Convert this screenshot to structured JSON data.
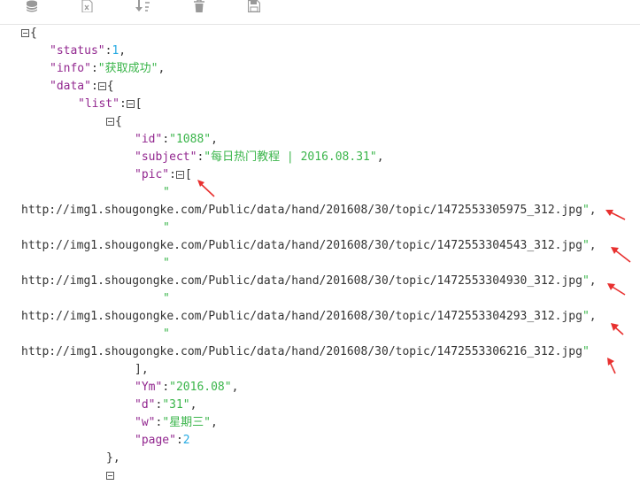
{
  "toolbar": {
    "items": [
      {
        "name": "database-icon"
      },
      {
        "name": "excel-export-icon"
      },
      {
        "name": "sort-icon"
      },
      {
        "name": "trash-icon"
      },
      {
        "name": "save-icon"
      }
    ]
  },
  "json": {
    "open_brace": "{",
    "close_brace": "}",
    "status_key": "\"status\"",
    "status_value": "1",
    "info_key": "\"info\"",
    "info_value": "\"获取成功\"",
    "data_key": "\"data\"",
    "list_key": "\"list\"",
    "open_bracket": "[",
    "close_bracket": "]",
    "colon": ":",
    "comma": ",",
    "quote": "\"",
    "id_key": "\"id\"",
    "id_value": "\"1088\"",
    "subject_key": "\"subject\"",
    "subject_value": "\"每日热门教程 | 2016.08.31\"",
    "pic_key": "\"pic\"",
    "pic_urls": [
      "http://img1.shougongke.com/Public/data/hand/201608/30/topic/1472553305975_312.jpg",
      "http://img1.shougongke.com/Public/data/hand/201608/30/topic/1472553304543_312.jpg",
      "http://img1.shougongke.com/Public/data/hand/201608/30/topic/1472553304930_312.jpg",
      "http://img1.shougongke.com/Public/data/hand/201608/30/topic/1472553304293_312.jpg",
      "http://img1.shougongke.com/Public/data/hand/201608/30/topic/1472553306216_312.jpg"
    ],
    "ym_key": "\"Ym\"",
    "ym_value": "\"2016.08\"",
    "d_key": "\"d\"",
    "d_value": "\"31\"",
    "w_key": "\"w\"",
    "w_value": "\"星期三\"",
    "page_key": "\"page\"",
    "page_value": "2",
    "item_close": "},"
  },
  "annotation": {
    "arrow_color": "#e8302f",
    "arrow_count": 6
  }
}
